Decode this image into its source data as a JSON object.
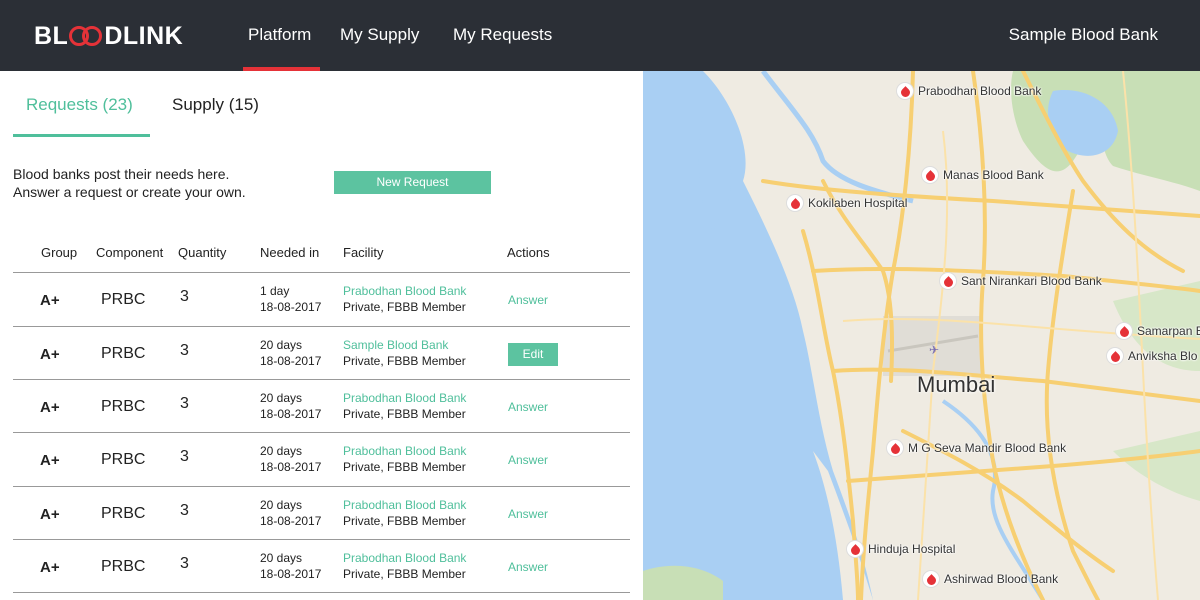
{
  "brand": {
    "logo_left": "BL",
    "logo_right": "DLINK"
  },
  "nav": {
    "items": [
      {
        "label": "Platform"
      },
      {
        "label": "My Supply"
      },
      {
        "label": "My Requests"
      }
    ],
    "active": "Platform",
    "org_name": "Sample Blood Bank"
  },
  "tabs": [
    {
      "label": "Requests (23)",
      "active": true
    },
    {
      "label": "Supply (15)",
      "active": false
    }
  ],
  "intro": {
    "line1": "Blood banks post their needs here.",
    "line2": "Answer a request or create your own."
  },
  "new_request_label": "New Request",
  "table": {
    "headers": {
      "group": "Group",
      "component": "Component",
      "quantity": "Quantity",
      "needed_in": "Needed in",
      "facility": "Facility",
      "actions": "Actions"
    },
    "rows": [
      {
        "group": "A+",
        "component": "PRBC",
        "quantity": "3",
        "needed": "1 day",
        "date": "18-08-2017",
        "facility": "Prabodhan Blood Bank",
        "facility_type": "Private, FBBB Member",
        "action": "Answer"
      },
      {
        "group": "A+",
        "component": "PRBC",
        "quantity": "3",
        "needed": "20 days",
        "date": "18-08-2017",
        "facility": "Sample Blood Bank",
        "facility_type": "Private, FBBB Member",
        "action": "Edit"
      },
      {
        "group": "A+",
        "component": "PRBC",
        "quantity": "3",
        "needed": "20 days",
        "date": "18-08-2017",
        "facility": "Prabodhan Blood Bank",
        "facility_type": "Private, FBBB Member",
        "action": "Answer"
      },
      {
        "group": "A+",
        "component": "PRBC",
        "quantity": "3",
        "needed": "20 days",
        "date": "18-08-2017",
        "facility": "Prabodhan Blood Bank",
        "facility_type": "Private, FBBB Member",
        "action": "Answer"
      },
      {
        "group": "A+",
        "component": "PRBC",
        "quantity": "3",
        "needed": "20 days",
        "date": "18-08-2017",
        "facility": "Prabodhan Blood Bank",
        "facility_type": "Private, FBBB Member",
        "action": "Answer"
      },
      {
        "group": "A+",
        "component": "PRBC",
        "quantity": "3",
        "needed": "20 days",
        "date": "18-08-2017",
        "facility": "Prabodhan Blood Bank",
        "facility_type": "Private, FBBB Member",
        "action": "Answer"
      }
    ]
  },
  "map": {
    "city": "Mumbai",
    "markers": [
      {
        "label": "Prabodhan Blood Bank"
      },
      {
        "label": "Manas Blood Bank"
      },
      {
        "label": "Kokilaben Hospital"
      },
      {
        "label": "Sant Nirankari Blood Bank"
      },
      {
        "label": "Samarpan Bl"
      },
      {
        "label": "Anviksha Blo"
      },
      {
        "label": "M G Seva Mandir Blood Bank"
      },
      {
        "label": "Hinduja Hospital"
      },
      {
        "label": "Ashirwad Blood Bank"
      }
    ]
  },
  "colors": {
    "accent": "#4fbf9b",
    "brand_red": "#e53238",
    "nav_bg": "#2b2f36"
  }
}
